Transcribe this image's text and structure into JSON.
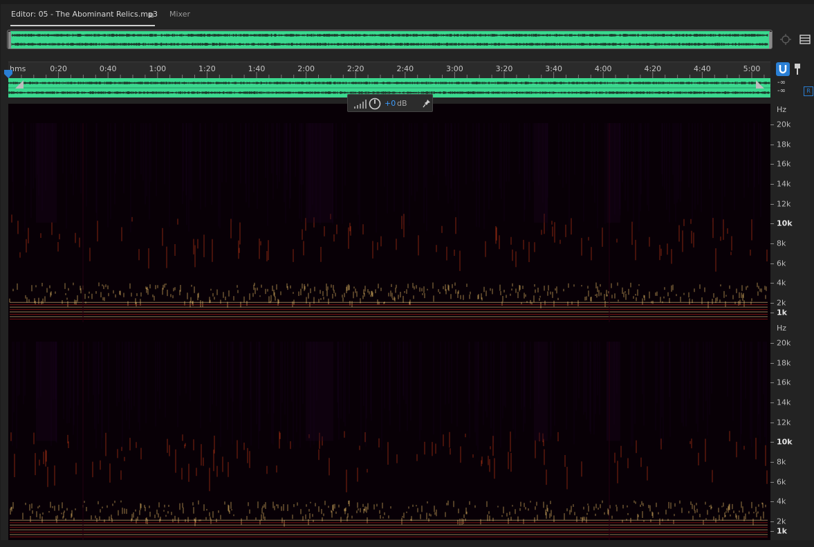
{
  "tabs": {
    "editor_label": "Editor: 05 - The Abominant Relics.mp3",
    "mixer_label": "Mixer",
    "menu_glyph": "≡"
  },
  "ruler": {
    "unit": "hms",
    "ticks": [
      "0:20",
      "0:40",
      "1:00",
      "1:20",
      "1:40",
      "2:00",
      "2:20",
      "2:40",
      "3:00",
      "3:20",
      "3:40",
      "4:00",
      "4:20",
      "4:40",
      "5:00"
    ]
  },
  "meter": {
    "left_db": "-∞",
    "right_db": "-∞",
    "channel": "R"
  },
  "hud": {
    "gain_value": "+0",
    "gain_unit": "dB"
  },
  "frequency_axis": {
    "unit": "Hz",
    "labels": [
      "20k",
      "18k",
      "16k",
      "14k",
      "12k",
      "10k",
      "8k",
      "6k",
      "4k",
      "2k",
      "1k"
    ]
  },
  "colors": {
    "waveform": "#3ad98f",
    "accent": "#2a7fd4",
    "hud_value": "#3c9dff"
  },
  "icons": {
    "menu": "hamburger-menu-icon",
    "zoom_target": "zoom-target-icon",
    "list": "list-view-icon",
    "snap": "snap-magnet-icon",
    "marker": "marker-icon",
    "playhead": "playhead-icon",
    "pin": "pin-icon"
  }
}
